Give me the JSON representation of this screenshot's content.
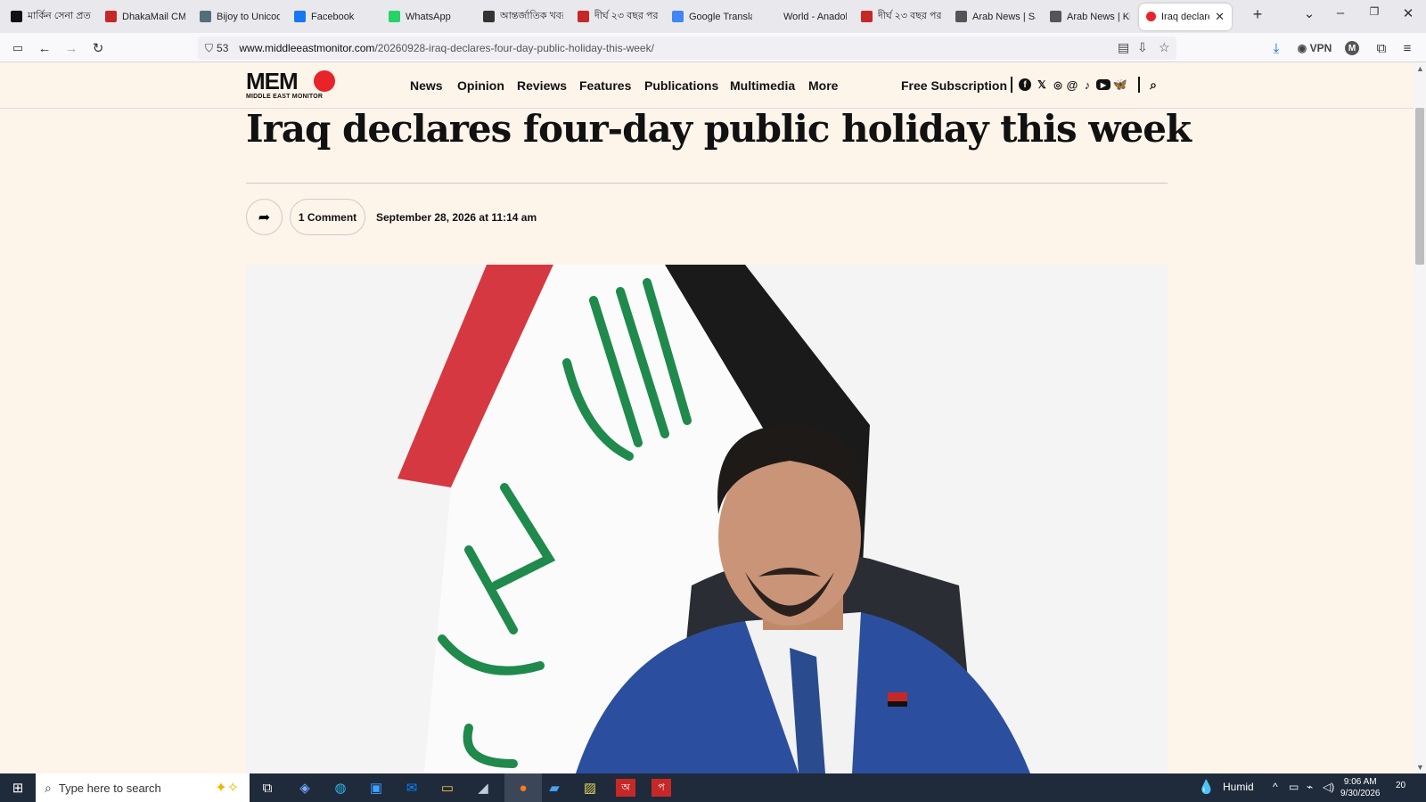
{
  "browser": {
    "tabs": [
      {
        "label": "মার্কিন সেনা প্রত",
        "icon": "m-icon",
        "color": "#111"
      },
      {
        "label": "DhakaMail CMS",
        "icon": "dhakamail-icon",
        "color": "#c62828"
      },
      {
        "label": "Bijoy to Unicode",
        "icon": "globe-icon",
        "color": "#546e7a"
      },
      {
        "label": "Facebook",
        "icon": "facebook-icon",
        "color": "#1877f2"
      },
      {
        "label": "WhatsApp",
        "icon": "whatsapp-icon",
        "color": "#25d366"
      },
      {
        "label": "আন্তর্জাতিক খবর",
        "icon": "news-icon",
        "color": "#333"
      },
      {
        "label": "দীর্ঘ ২৩ বছর পর",
        "icon": "prothom-icon",
        "color": "#c62828"
      },
      {
        "label": "Google Translate",
        "icon": "translate-icon",
        "color": "#4285f4"
      },
      {
        "label": "World - Anadolu",
        "icon": "anadolu-icon",
        "color": "#e9e9ed"
      },
      {
        "label": "দীর্ঘ ২৩ বছর পর",
        "icon": "prothom-icon",
        "color": "#c62828"
      },
      {
        "label": "Arab News | Sau",
        "icon": "arabnews-icon",
        "color": "#555"
      },
      {
        "label": "Arab News | Kin",
        "icon": "arabnews-icon",
        "color": "#555"
      }
    ],
    "active_tab": {
      "label": "Iraq declares",
      "icon": "memo-icon",
      "color": "#e8232a"
    },
    "url_host": "www.middleeastmonitor.com",
    "url_path": "/20260928-iraq-declares-four-day-public-holiday-this-week/",
    "tracker_count": "53",
    "vpn_label": "VPN",
    "account_initial": "M"
  },
  "site": {
    "logo_text": "MEM",
    "logo_sub": "MIDDLE EAST MONITOR",
    "nav": [
      "News",
      "Opinion",
      "Reviews",
      "Features",
      "Publications",
      "Multimedia",
      "More"
    ],
    "free_subscription": "Free Subscription",
    "social": [
      "facebook-icon",
      "x-icon",
      "instagram-icon",
      "threads-icon",
      "tiktok-icon",
      "youtube-icon",
      "bluesky-icon"
    ]
  },
  "article": {
    "title": "Iraq declares four-day public holiday this week",
    "comments": "1 Comment",
    "date": "September 28, 2026 at 11:14 am"
  },
  "taskbar": {
    "search_placeholder": "Type here to search",
    "weather": "Humid",
    "time": "9:06 AM",
    "date": "9/30/2026",
    "notifications": "20"
  },
  "colors": {
    "brand": "#e8232a",
    "page_bg": "#fdf4ea",
    "taskbar": "#1f2a3a"
  }
}
